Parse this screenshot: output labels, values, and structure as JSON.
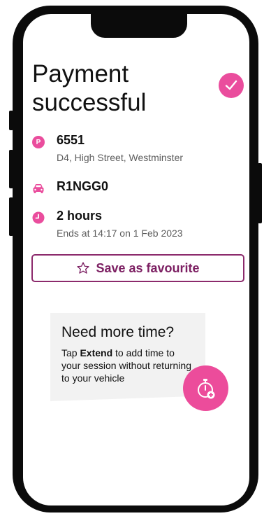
{
  "header": {
    "title": "Payment successful"
  },
  "location": {
    "badge": "P",
    "code": "6551",
    "address": "D4, High Street, Westminster"
  },
  "vehicle": {
    "plate": "R1NGG0"
  },
  "duration": {
    "label": "2 hours",
    "ends": "Ends at 14:17 on 1 Feb 2023"
  },
  "actions": {
    "save_label": "Save as favourite"
  },
  "tip": {
    "title": "Need more time?",
    "body_prefix": "Tap ",
    "body_emphasis": "Extend",
    "body_suffix": " to add time to your session without returning to your vehicle"
  },
  "icons": {
    "success": "check-circle-icon",
    "location": "parking-icon",
    "vehicle": "car-icon",
    "duration": "clock-icon",
    "save": "star-outline-icon",
    "extend": "stopwatch-plus-icon"
  },
  "colors": {
    "accent": "#ea4d9d",
    "button_text": "#7c1f62",
    "muted_text": "#5d5d5d",
    "card_bg": "#f2f2f2"
  }
}
